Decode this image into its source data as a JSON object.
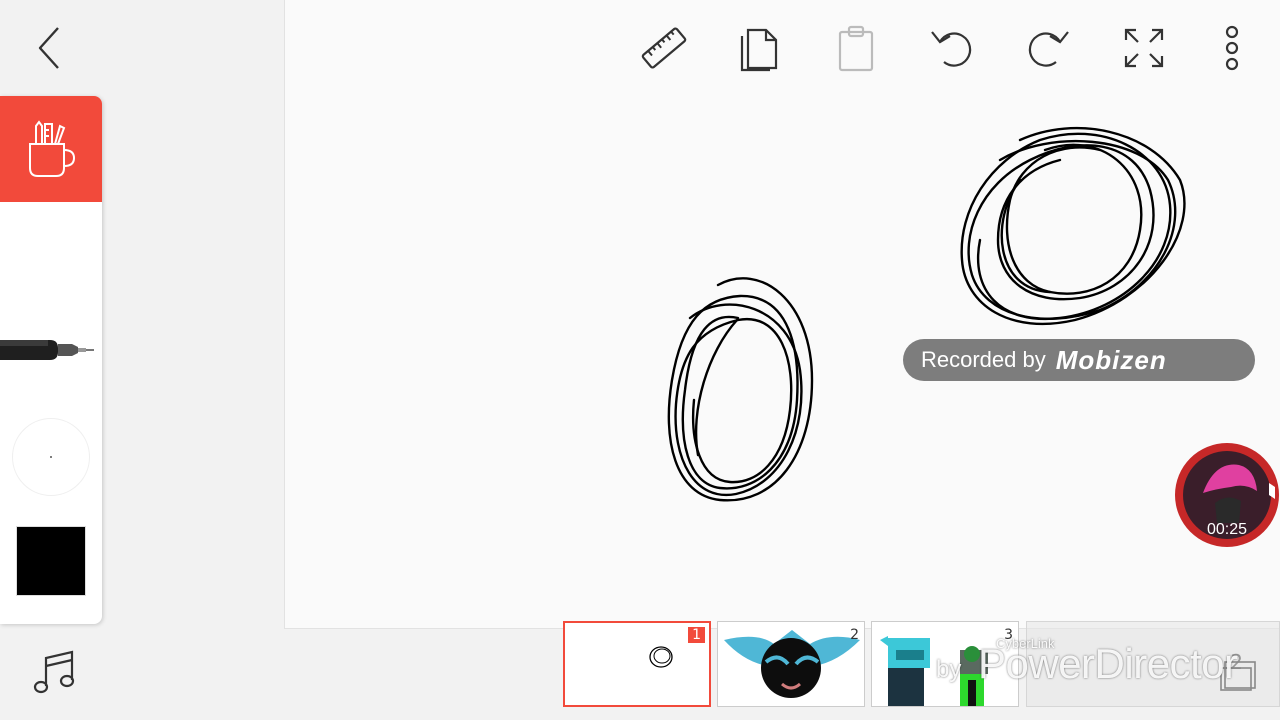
{
  "toolbar": {
    "back": "chevron-left-icon",
    "tools": [
      "ruler-icon",
      "copy-icon",
      "paste-icon",
      "undo-icon",
      "redo-icon",
      "fullscreen-icon",
      "more-vert-icon"
    ]
  },
  "sidebar": {
    "tool_box_icon": "pencil-cup-icon",
    "pen_icon": "pen-icon",
    "brush_size_label": "brush-size",
    "color_swatch": "#000000",
    "accent": "#f24a3b"
  },
  "music_icon": "music-note-icon",
  "watermark": {
    "text": "Recorded by",
    "brand": "Mobizen"
  },
  "recorder": {
    "time": "00:25"
  },
  "frames": [
    {
      "number": "1",
      "active": true
    },
    {
      "number": "2",
      "active": false
    },
    {
      "number": "3",
      "active": false
    }
  ],
  "frame4": {
    "number": "2"
  },
  "powerdirector": {
    "small": "CyberLink",
    "by": "by",
    "brand": "PowerDirector"
  }
}
